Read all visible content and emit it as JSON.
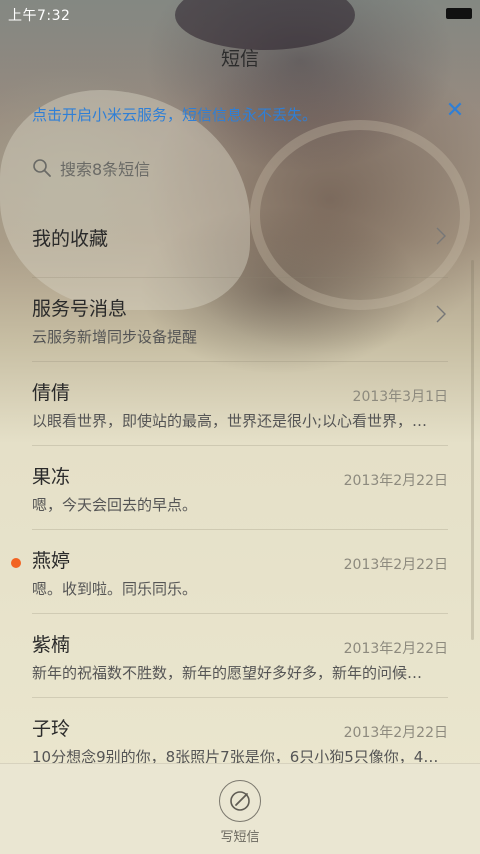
{
  "status_bar": {
    "time": "上午7:32"
  },
  "header": {
    "title": "短信"
  },
  "banner": {
    "text": "点击开启小米云服务，短信信息永不丢失。",
    "close_label": "✕"
  },
  "search": {
    "placeholder": "搜索8条短信"
  },
  "favorites": {
    "label": "我的收藏"
  },
  "service": {
    "title": "服务号消息",
    "subtitle": "云服务新增同步设备提醒"
  },
  "conversations": [
    {
      "name": "倩倩",
      "date": "2013年3月1日",
      "preview": "以眼看世界，即使站的最高，世界还是很小;以心看世界，…",
      "unread": false
    },
    {
      "name": "果冻",
      "date": "2013年2月22日",
      "preview": "嗯，今天会回去的早点。",
      "unread": false
    },
    {
      "name": "燕婷",
      "date": "2013年2月22日",
      "preview": "嗯。收到啦。同乐同乐。",
      "unread": true
    },
    {
      "name": "紫楠",
      "date": "2013年2月22日",
      "preview": "新年的祝福数不胜数，新年的愿望好多好多，新年的问候…",
      "unread": false
    },
    {
      "name": "子玲",
      "date": "2013年2月22日",
      "preview": "10分想念9别的你，8张照片7张是你，6只小狗5只像你，4…",
      "unread": false
    }
  ],
  "compose": {
    "label": "写短信"
  },
  "colors": {
    "accent": "#2f7fd6",
    "unread_dot": "#f26322"
  },
  "icons": {
    "search": "search-icon",
    "chevron": "chevron-right-icon",
    "compose": "compose-icon",
    "close": "close-icon"
  }
}
